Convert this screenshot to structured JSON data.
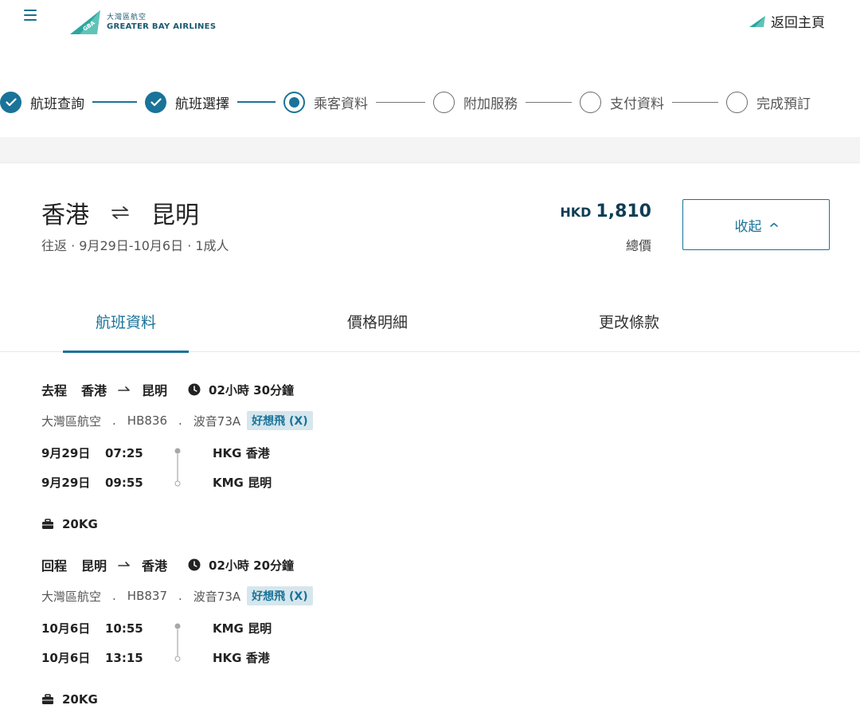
{
  "header": {
    "logo_cn": "大灣區航空",
    "logo_en": "GREATER BAY AIRLINES",
    "logo_mark": "GBA",
    "home_link": "返回主頁"
  },
  "steps": [
    {
      "label": "航班查詢",
      "state": "done"
    },
    {
      "label": "航班選擇",
      "state": "done"
    },
    {
      "label": "乘客資料",
      "state": "current"
    },
    {
      "label": "附加服務",
      "state": "todo"
    },
    {
      "label": "支付資料",
      "state": "todo"
    },
    {
      "label": "完成預訂",
      "state": "todo"
    }
  ],
  "summary": {
    "origin": "香港",
    "destination": "昆明",
    "subtitle": "往返 · 9月29日-10月6日 · 1成人",
    "currency": "HKD",
    "amount": "1,810",
    "total_label": "總價",
    "collapse_label": "收起"
  },
  "tabs": [
    {
      "label": "航班資料",
      "active": true
    },
    {
      "label": "價格明細",
      "active": false
    },
    {
      "label": "更改條款",
      "active": false
    }
  ],
  "segments": [
    {
      "direction": "去程",
      "from": "香港",
      "to": "昆明",
      "duration": "02小時 30分鐘",
      "airline": "大灣區航空",
      "flight_no": "HB836",
      "aircraft": "波音73A",
      "fare": "好想飛 (X)",
      "depart_date": "9月29日",
      "depart_time": "07:25",
      "depart_airport": "HKG 香港",
      "arrive_date": "9月29日",
      "arrive_time": "09:55",
      "arrive_airport": "KMG 昆明",
      "baggage": "20KG"
    },
    {
      "direction": "回程",
      "from": "昆明",
      "to": "香港",
      "duration": "02小時 20分鐘",
      "airline": "大灣區航空",
      "flight_no": "HB837",
      "aircraft": "波音73A",
      "fare": "好想飛 (X)",
      "depart_date": "10月6日",
      "depart_time": "10:55",
      "depart_airport": "KMG 昆明",
      "arrive_date": "10月6日",
      "arrive_time": "13:15",
      "arrive_airport": "HKG 香港",
      "baggage": "20KG"
    }
  ],
  "meta_separator": ".",
  "colors": {
    "brand": "#1a7398",
    "brand_dark": "#0f3d55",
    "badge_bg": "#d6e6ed",
    "band_bg": "#f4f4f4"
  }
}
